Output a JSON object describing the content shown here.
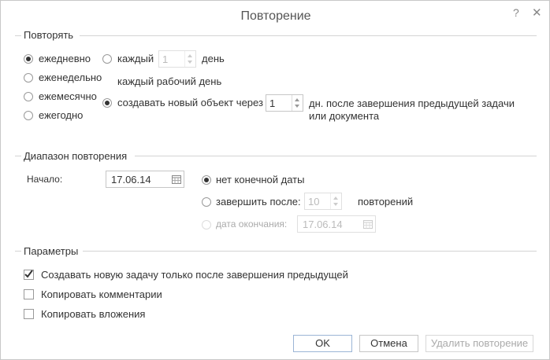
{
  "dialog": {
    "title": "Повторение",
    "help": "?",
    "close": "✕"
  },
  "repeat": {
    "header": "Повторять",
    "periods": [
      "ежедневно",
      "еженедельно",
      "ежемесячно",
      "ежегодно"
    ],
    "selected_period": "ежедневно",
    "every_label": "каждый",
    "every_value": "1",
    "every_unit": "день",
    "every_workday": "каждый рабочий день",
    "create_new_label": "создавать новый объект через",
    "create_new_value": "1",
    "create_new_suffix_line1": "дн. после завершения предыдущей задачи",
    "create_new_suffix_line2": "или документа",
    "selected_mode": "создавать новый объект через"
  },
  "range": {
    "header": "Диапазон повторения",
    "start_label": "Начало:",
    "start_value": "17.06.14",
    "no_end": "нет конечной даты",
    "end_after": "завершить после:",
    "end_after_value": "10",
    "end_after_unit": "повторений",
    "end_date_label": "дата окончания:",
    "end_date_value": "17.06.14",
    "selected": "нет конечной даты"
  },
  "params": {
    "header": "Параметры",
    "items": [
      {
        "label": "Создавать новую задачу только после завершения предыдущей",
        "checked": true
      },
      {
        "label": "Копировать комментарии",
        "checked": false
      },
      {
        "label": "Копировать вложения",
        "checked": false
      }
    ]
  },
  "buttons": {
    "ok": "OK",
    "cancel": "Отмена",
    "delete": "Удалить повторение"
  }
}
